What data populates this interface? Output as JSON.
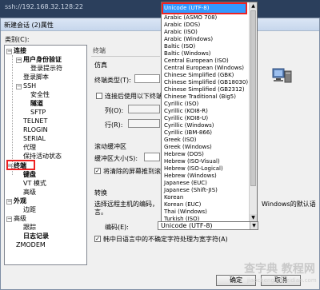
{
  "background": {
    "address": "ssh://192.168.32.128:22"
  },
  "window": {
    "title": "新建会话 (2)属性"
  },
  "category_label": "类别(C):",
  "tree": {
    "connection": "连接",
    "user_auth": "用户身份验证",
    "login_prompt": "登录提示符",
    "login_script": "登录脚本",
    "ssh": "SSH",
    "security": "安全性",
    "tunnel": "隧道",
    "sftp": "SFTP",
    "telnet": "TELNET",
    "rlogin": "RLOGIN",
    "serial": "SERIAL",
    "proxy": "代理",
    "keepalive": "保持活动状态",
    "terminal": "终端",
    "keyboard": "键盘",
    "vt_mode": "VT 模式",
    "advanced": "高级",
    "appearance": "外观",
    "margin": "边距",
    "advanced2": "高级",
    "trace": "跟踪",
    "logging": "日志记录",
    "zmodem": "ZMODEM"
  },
  "panel": {
    "header": "终端",
    "emulation_section": "仿真",
    "terminal_type_label": "终端类型(T):",
    "use_following_size": "连接后使用以下终端",
    "columns_label": "列(O):",
    "rows_label": "行(R):",
    "scroll_section": "滚动缓冲区",
    "buffer_size_label": "缓冲区大小(S):",
    "push_erased": "将清除的屏幕推到滚",
    "convert_section": "转换",
    "convert_desc": "选择远程主机的编码，",
    "convert_desc_tail": "Windows的默认语",
    "convert_desc_line2": "言。",
    "encoding_label": "编码(E):",
    "encoding_value": "Unicode (UTF-8)",
    "cjk_ambiguous": "韩中日语言中的不确定字符处理为宽字符(A)"
  },
  "dropdown": {
    "selected": "Unicode (UTF-8)",
    "options": [
      "Arabic (ASMO 708)",
      "Arabic (DOS)",
      "Arabic (ISO)",
      "Arabic (Windows)",
      "Baltic (ISO)",
      "Baltic (Windows)",
      "Central European (ISO)",
      "Central European (Windows)",
      "Chinese Simplified (GBK)",
      "Chinese Simplified (GB18030)",
      "Chinese Simplified (GB2312)",
      "Chinese Traditional (Big5)",
      "Cyrillic (ISO)",
      "Cyrillic (KOI8-R)",
      "Cyrillic (KOI8-U)",
      "Cyrillic (Windows)",
      "Cyrillic (IBM-866)",
      "Greek (ISO)",
      "Greek (Windows)",
      "Hebrew (DOS)",
      "Hebrew (ISO-Visual)",
      "Hebrew (ISO-Logical)",
      "Hebrew (Windows)",
      "Japanese (EUC)",
      "Japanese (Shift-JIS)",
      "Korean",
      "Korean (EUC)",
      "Thai (Windows)",
      "Turkish (ISO)"
    ]
  },
  "buttons": {
    "ok": "确定",
    "cancel": "取消"
  },
  "watermark": {
    "brand": "查字典 教程网",
    "url": "jiaocheng.chazidian.com"
  },
  "colors": {
    "highlight": "#3399ff",
    "annotation_red": "#e22222"
  }
}
